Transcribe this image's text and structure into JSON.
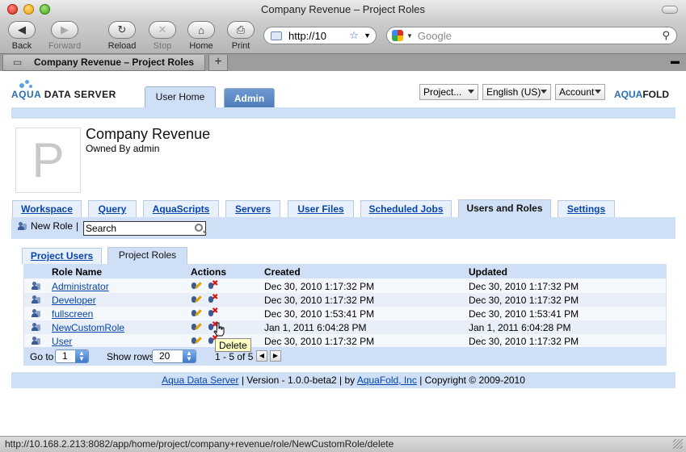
{
  "browser": {
    "window_title": "Company Revenue – Project Roles",
    "tab_title": "Company Revenue – Project Roles",
    "nav": {
      "back": "Back",
      "forward": "Forward",
      "reload": "Reload",
      "stop": "Stop",
      "home": "Home",
      "print": "Print"
    },
    "url": "http://10",
    "search_placeholder": "Google",
    "new_tab": "+",
    "status_url": "http://10.168.2.213:8082/app/home/project/company+revenue/role/NewCustomRole/delete"
  },
  "app": {
    "logo_left_aqua": "AQUA",
    "logo_left_rest": " DATA SERVER",
    "logo_right_aqua": "AQUA",
    "logo_right_fold": "FOLD",
    "top_tabs": [
      "User Home",
      "Admin"
    ],
    "selects": {
      "project": "Project...",
      "language": "English (US)",
      "account": "Account"
    }
  },
  "project": {
    "image_letter": "P",
    "title": "Company Revenue",
    "owner": "Owned By admin"
  },
  "project_tabs": [
    "Workspace",
    "Query",
    "AquaScripts",
    "Servers",
    "User Files",
    "Scheduled Jobs",
    "Users and Roles",
    "Settings"
  ],
  "toolbar": {
    "new_role": "New Role",
    "separator": "|",
    "search_value": "Search"
  },
  "subtabs": [
    "Project Users",
    "Project Roles"
  ],
  "table": {
    "headers": [
      "Role Name",
      "Actions",
      "Created",
      "Updated"
    ],
    "rows": [
      {
        "name": "Administrator",
        "created": "Dec 30, 2010 1:17:32 PM",
        "updated": "Dec 30, 2010 1:17:32 PM"
      },
      {
        "name": "Developer",
        "created": "Dec 30, 2010 1:17:32 PM",
        "updated": "Dec 30, 2010 1:17:32 PM"
      },
      {
        "name": "fullscreen",
        "created": "Dec 30, 2010 1:53:41 PM",
        "updated": "Dec 30, 2010 1:53:41 PM"
      },
      {
        "name": "NewCustomRole",
        "created": "Jan 1, 2011 6:04:28 PM",
        "updated": "Jan 1, 2011 6:04:28 PM"
      },
      {
        "name": "User",
        "created": "Dec 30, 2010 1:17:32 PM",
        "updated": "Dec 30, 2010 1:17:32 PM"
      }
    ],
    "footer": {
      "goto_label": "Go to",
      "goto_value": "1",
      "show_rows_label": "Show rows",
      "show_rows_value": "20",
      "range": "1 - 5 of 5"
    }
  },
  "tooltip": "Delete",
  "footer": {
    "link1": "Aqua Data Server",
    "middle": " | Version - 1.0.0-beta2 | by ",
    "link2": "AquaFold, Inc",
    "end": " | Copyright © 2009-2010"
  }
}
